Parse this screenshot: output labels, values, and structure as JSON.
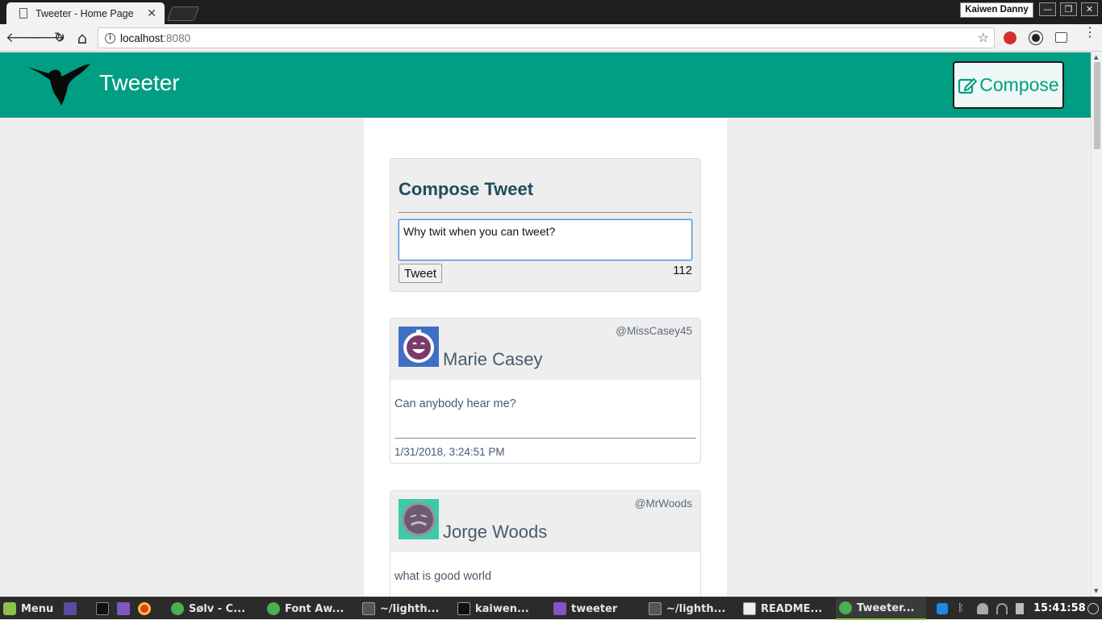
{
  "browser": {
    "tab_title": "Tweeter - Home Page",
    "tab_close": "✕",
    "profile_name": "Kaiwen Danny",
    "url_host": "localhost",
    "url_port": ":8080",
    "back_icon": "🡐",
    "forward_icon": "🡒",
    "reload_icon": "↻",
    "home_icon": "⌂",
    "star_icon": "☆",
    "info_icon": "i",
    "win_min": "—",
    "win_restore": "❐",
    "win_close": "✕"
  },
  "nav": {
    "brand": "Tweeter",
    "compose_label": "Compose"
  },
  "compose": {
    "heading": "Compose Tweet",
    "textarea_value": "Why twit when you can tweet?",
    "button_label": "Tweet",
    "counter": "112"
  },
  "tweets": [
    {
      "name": "Marie Casey",
      "handle": "@MissCasey45",
      "text": "Can anybody hear me?",
      "timestamp": "1/31/2018, 3:24:51 PM",
      "avatar_bg": "#3e6fc4",
      "avatar_face": "#7b3a6c"
    },
    {
      "name": "Jorge Woods",
      "handle": "@MrWoods",
      "text": "what is good world",
      "avatar_bg": "#3ec9a8",
      "avatar_face": "#6d5a6e"
    }
  ],
  "taskbar": {
    "menu_label": "Menu",
    "items": [
      {
        "label": "Sølv - C...",
        "icon": "chrome-icon"
      },
      {
        "label": "Font Aw...",
        "icon": "chrome-icon"
      },
      {
        "label": "~/lighth...",
        "icon": "sublime-icon"
      },
      {
        "label": "kaiwen...",
        "icon": "terminal-icon"
      },
      {
        "label": "tweeter",
        "icon": "folder-icon"
      },
      {
        "label": "~/lighth...",
        "icon": "sublime-icon"
      },
      {
        "label": "README...",
        "icon": "text-editor-icon"
      },
      {
        "label": "Tweeter...",
        "icon": "chrome-icon"
      }
    ],
    "clock": "15:41:58"
  },
  "colors": {
    "brand": "#009e82",
    "nav_text": "#ffffff",
    "heading": "#234a5c"
  }
}
